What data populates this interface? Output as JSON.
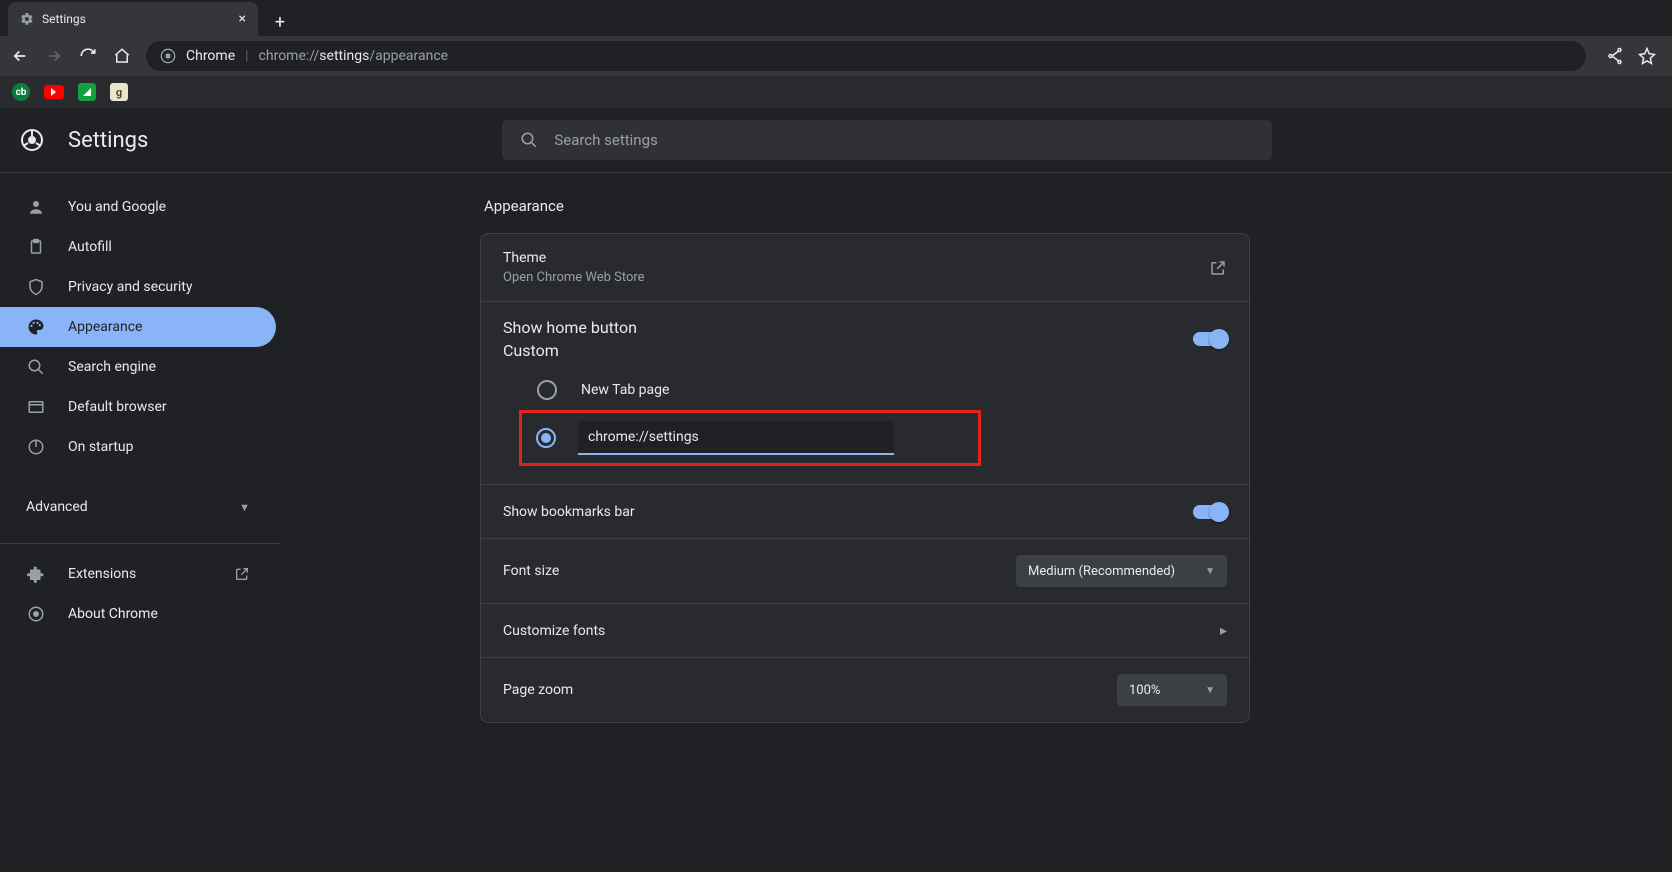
{
  "browser": {
    "tab_title": "Settings",
    "omnibox": {
      "origin_label": "Chrome",
      "url_prefix": "chrome://",
      "url_bold": "settings",
      "url_suffix": "/appearance"
    }
  },
  "header": {
    "title": "Settings",
    "search_placeholder": "Search settings"
  },
  "sidebar": {
    "items": [
      {
        "label": "You and Google"
      },
      {
        "label": "Autofill"
      },
      {
        "label": "Privacy and security"
      },
      {
        "label": "Appearance"
      },
      {
        "label": "Search engine"
      },
      {
        "label": "Default browser"
      },
      {
        "label": "On startup"
      }
    ],
    "advanced": "Advanced",
    "extensions": "Extensions",
    "about": "About Chrome"
  },
  "main": {
    "section_title": "Appearance",
    "theme": {
      "title": "Theme",
      "subtitle": "Open Chrome Web Store"
    },
    "home_button": {
      "title": "Show home button",
      "subtitle": "Custom",
      "radio_new_tab": "New Tab page",
      "custom_url_value": "chrome://settings"
    },
    "bookmarks_bar": "Show bookmarks bar",
    "font_size": {
      "label": "Font size",
      "value": "Medium (Recommended)"
    },
    "customize_fonts": "Customize fonts",
    "page_zoom": {
      "label": "Page zoom",
      "value": "100%"
    }
  }
}
